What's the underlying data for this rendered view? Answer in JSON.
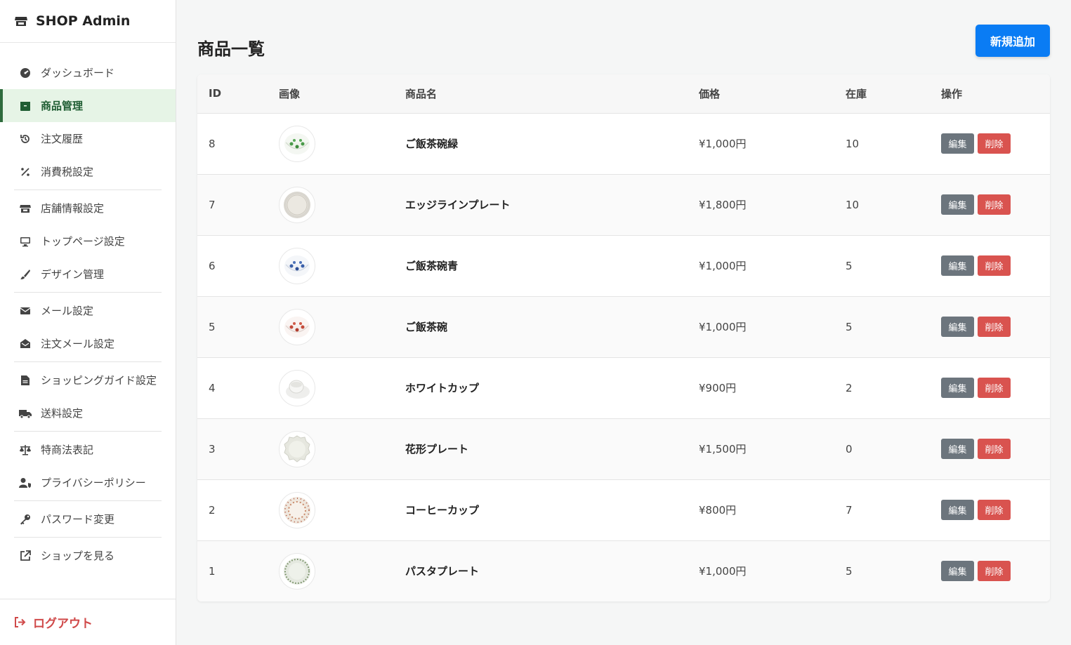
{
  "brand": {
    "title": "SHOP Admin",
    "icon": "store-icon"
  },
  "sidebar": {
    "items": [
      {
        "label": "ダッシュボード",
        "icon": "dashboard-gauge-icon"
      },
      {
        "label": "商品管理",
        "icon": "box-icon",
        "active": true
      },
      {
        "label": "注文履歴",
        "icon": "history-icon"
      },
      {
        "label": "消費税設定",
        "icon": "percent-icon"
      },
      {
        "label": "店舗情報設定",
        "icon": "store-icon"
      },
      {
        "label": "トップページ設定",
        "icon": "monitor-icon"
      },
      {
        "label": "デザイン管理",
        "icon": "brush-icon"
      },
      {
        "label": "メール設定",
        "icon": "envelope-icon"
      },
      {
        "label": "注文メール設定",
        "icon": "mail-inbox-icon"
      },
      {
        "label": "ショッピングガイド設定",
        "icon": "document-icon"
      },
      {
        "label": "送料設定",
        "icon": "truck-icon"
      },
      {
        "label": "特商法表記",
        "icon": "scale-icon"
      },
      {
        "label": "プライバシーポリシー",
        "icon": "user-shield-icon"
      },
      {
        "label": "パスワード変更",
        "icon": "key-icon"
      },
      {
        "label": "ショップを見る",
        "icon": "external-link-icon"
      }
    ],
    "logout_label": "ログアウト"
  },
  "main": {
    "title": "商品一覧",
    "add_button": "新規追加",
    "table": {
      "headers": {
        "id": "ID",
        "image": "画像",
        "name": "商品名",
        "price": "価格",
        "stock": "在庫",
        "actions": "操作"
      },
      "edit_label": "編集",
      "delete_label": "削除",
      "rows": [
        {
          "id": "8",
          "name": "ご飯茶碗緑",
          "price": "¥1,000円",
          "stock": "10",
          "image": "green-rice-bowl"
        },
        {
          "id": "7",
          "name": "エッジラインプレート",
          "price": "¥1,800円",
          "stock": "10",
          "image": "edge-line-plate"
        },
        {
          "id": "6",
          "name": "ご飯茶碗青",
          "price": "¥1,000円",
          "stock": "5",
          "image": "blue-rice-bowl"
        },
        {
          "id": "5",
          "name": "ご飯茶碗",
          "price": "¥1,000円",
          "stock": "5",
          "image": "red-rice-bowl"
        },
        {
          "id": "4",
          "name": "ホワイトカップ",
          "price": "¥900円",
          "stock": "2",
          "image": "white-cup"
        },
        {
          "id": "3",
          "name": "花形プレート",
          "price": "¥1,500円",
          "stock": "0",
          "image": "flower-plate"
        },
        {
          "id": "2",
          "name": "コーヒーカップ",
          "price": "¥800円",
          "stock": "7",
          "image": "coffee-cup"
        },
        {
          "id": "1",
          "name": "パスタプレート",
          "price": "¥1,000円",
          "stock": "5",
          "image": "pasta-plate"
        }
      ]
    }
  },
  "colors": {
    "accent": "#0a7cf4",
    "active_bg": "#e6f4e6",
    "active_text": "#1f5d33",
    "danger": "#d9534f",
    "secondary": "#6c757d"
  }
}
